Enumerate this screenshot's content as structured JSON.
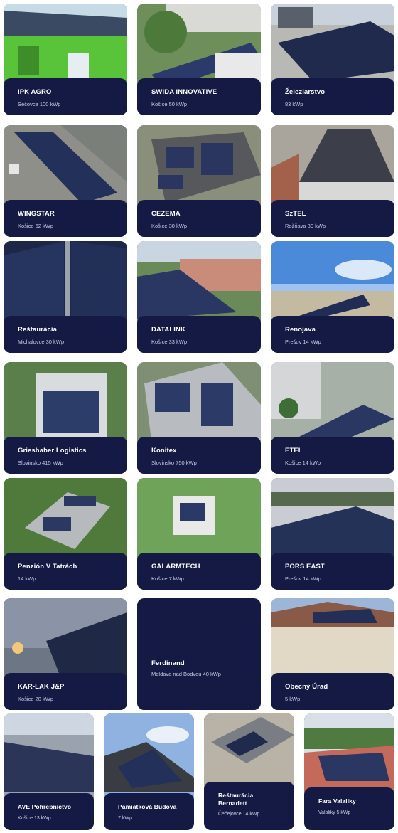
{
  "projects": [
    {
      "name": "IPK AGRO",
      "subtitle": "Sečovce 100 kWp"
    },
    {
      "name": "SWIDA INNOVATIVE",
      "subtitle": "Košice 50 kWp"
    },
    {
      "name": "Železiarstvo",
      "subtitle": "83 kWp"
    },
    {
      "name": "WINGSTAR",
      "subtitle": "Košice 62 kWp"
    },
    {
      "name": "CEZEMA",
      "subtitle": "Košice 30 kWp"
    },
    {
      "name": "SzTEL",
      "subtitle": "Rožňava 30 kWp"
    },
    {
      "name": "Reštaurácia",
      "subtitle": "Michalovce 30 kWp"
    },
    {
      "name": "DATALINK",
      "subtitle": "Košice 33 kWp"
    },
    {
      "name": "Renojava",
      "subtitle": "Prešov 14 kWp"
    },
    {
      "name": "Grieshaber Logistics",
      "subtitle": "Slovinsko 415 kWp"
    },
    {
      "name": "Konitex",
      "subtitle": "Slovinsko 750 kWp"
    },
    {
      "name": "ETEL",
      "subtitle": "Košice 14 kWp"
    },
    {
      "name": "Penzión V Tatrách",
      "subtitle": "14 kWp"
    },
    {
      "name": "GALARMTECH",
      "subtitle": "Košice 7 kWp"
    },
    {
      "name": "PORS EAST",
      "subtitle": "Prešov 14 kWp"
    },
    {
      "name": "KAR-LAK J&P",
      "subtitle": "Košice 20 kWp"
    },
    {
      "name": "Ferdinand",
      "subtitle": "Moldava nad Bodvou 40 kWp"
    },
    {
      "name": "Obecný Úrad",
      "subtitle": "5 kWp"
    },
    {
      "name": "AVE Pohrebníctvo",
      "subtitle": "Košice 13 kWp"
    },
    {
      "name": "Pamiatková Budova",
      "subtitle": "7 kWp"
    },
    {
      "name": "Reštaurácia Bernadett",
      "subtitle": "Čečejovce 14 kWp"
    },
    {
      "name": "Fara Valaliky",
      "subtitle": "Valaliky 5 kWp"
    }
  ]
}
